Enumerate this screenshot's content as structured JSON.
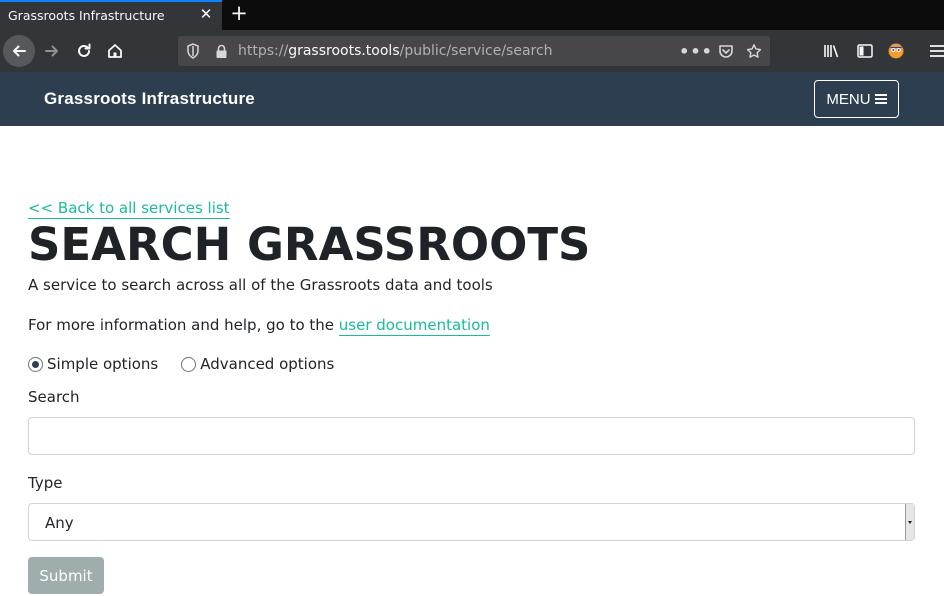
{
  "browser": {
    "tab_title": "Grassroots Infrastructure",
    "tab_close": "✕",
    "new_tab": "+",
    "url_protocol": "https://",
    "url_domain": "grassroots.tools",
    "url_path": "/public/service/search",
    "url_more": "•••"
  },
  "header": {
    "brand": "Grassroots Infrastructure",
    "menu_label": "MENU"
  },
  "page": {
    "back_link": "<< Back to all services list",
    "title": "SEARCH GRASSROOTS",
    "subtitle": "A service to search across all of the Grassroots data and tools",
    "help_prefix": "For more information and help, go to the ",
    "help_link": "user documentation"
  },
  "form": {
    "options": [
      {
        "label": "Simple options",
        "checked": true
      },
      {
        "label": "Advanced options",
        "checked": false
      }
    ],
    "search_label": "Search",
    "search_value": "",
    "type_label": "Type",
    "type_value": "Any",
    "submit_label": "Submit"
  }
}
